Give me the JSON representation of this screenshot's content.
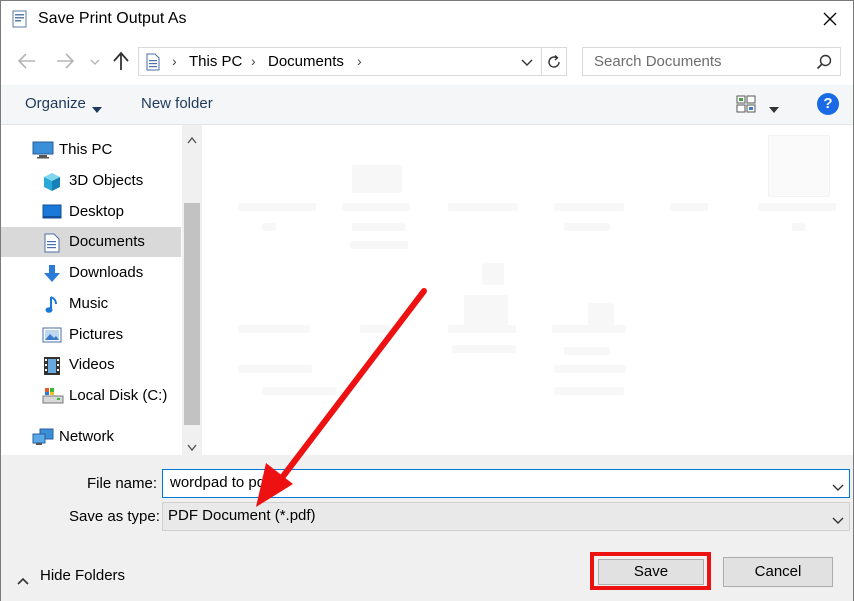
{
  "window": {
    "title": "Save Print Output As"
  },
  "address": {
    "crumbs": [
      "This PC",
      "Documents"
    ],
    "search_placeholder": "Search Documents"
  },
  "toolbar": {
    "organize_label": "Organize",
    "new_folder_label": "New folder",
    "help_label": "?"
  },
  "sidebar": {
    "items": [
      {
        "label": "This PC",
        "icon": "computer-icon",
        "selected": false
      },
      {
        "label": "3D Objects",
        "icon": "cube-icon",
        "selected": false
      },
      {
        "label": "Desktop",
        "icon": "desktop-icon",
        "selected": false
      },
      {
        "label": "Documents",
        "icon": "document-icon",
        "selected": true
      },
      {
        "label": "Downloads",
        "icon": "download-arrow-icon",
        "selected": false
      },
      {
        "label": "Music",
        "icon": "music-note-icon",
        "selected": false
      },
      {
        "label": "Pictures",
        "icon": "picture-icon",
        "selected": false
      },
      {
        "label": "Videos",
        "icon": "film-icon",
        "selected": false
      },
      {
        "label": "Local Disk (C:)",
        "icon": "drive-icon",
        "selected": false
      },
      {
        "label": "Network",
        "icon": "network-icon",
        "selected": false
      }
    ]
  },
  "form": {
    "file_name_label": "File name:",
    "file_name_value": "wordpad to pdf",
    "save_type_label": "Save as type:",
    "save_type_value": "PDF Document (*.pdf)"
  },
  "footer": {
    "hide_folders_label": "Hide Folders",
    "save_label": "Save",
    "cancel_label": "Cancel"
  },
  "colors": {
    "annotation_red": "#ee1111",
    "help_blue": "#1a6ae6",
    "focus_blue": "#0078d7"
  }
}
